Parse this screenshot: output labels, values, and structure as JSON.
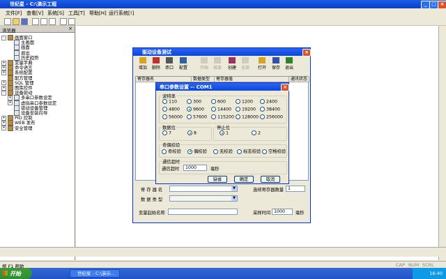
{
  "app": {
    "title": "世纪星 - C:\\演示工程"
  },
  "menu": [
    "文件[F]",
    "查看[V]",
    "系统[S]",
    "工具[T]",
    "帮助[H]",
    "运行系统[!]"
  ],
  "sidebar": {
    "header": "浏览器",
    "items": [
      {
        "label": "画面窗口",
        "level": 0,
        "expander": "-"
      },
      {
        "label": "主画面",
        "level": 1,
        "expander": ""
      },
      {
        "label": "画面",
        "level": 1,
        "expander": ""
      },
      {
        "label": "退出",
        "level": 1,
        "expander": ""
      },
      {
        "label": "历史趋势",
        "level": 1,
        "expander": ""
      },
      {
        "label": "变量字典",
        "level": 0,
        "expander": "+"
      },
      {
        "label": "命令语言",
        "level": 0,
        "expander": "+"
      },
      {
        "label": "系统配置",
        "level": 0,
        "expander": "+"
      },
      {
        "label": "配方管理",
        "level": 0,
        "expander": ""
      },
      {
        "label": "SQL 管理",
        "level": 0,
        "expander": "+"
      },
      {
        "label": "图库控件",
        "level": 0,
        "expander": "+"
      },
      {
        "label": "设备驱动",
        "level": 0,
        "expander": "-"
      },
      {
        "label": "多串口参数设定",
        "level": 1,
        "expander": "+"
      },
      {
        "label": "虚拟串口参数设定",
        "level": 1,
        "expander": "+"
      },
      {
        "label": "驱动设备管理",
        "level": 1,
        "expander": ""
      },
      {
        "label": "设备安装向导",
        "level": 1,
        "expander": ""
      },
      {
        "label": "PID 控制",
        "level": 0,
        "expander": "+"
      },
      {
        "label": "WEB 发布",
        "level": 0,
        "expander": "+"
      },
      {
        "label": "安全管理",
        "level": 0,
        "expander": "+"
      }
    ]
  },
  "driver_dialog": {
    "title": "驱动设备测试",
    "toolbar": [
      {
        "label": "增加",
        "enabled": true
      },
      {
        "label": "删除",
        "enabled": true
      },
      {
        "label": "串口",
        "enabled": true
      },
      {
        "label": "配置",
        "enabled": true
      },
      {
        "label": "开始",
        "enabled": false
      },
      {
        "label": "结束",
        "enabled": false
      },
      {
        "label": "创建",
        "enabled": true
      },
      {
        "label": "全部",
        "enabled": false
      },
      {
        "label": "打开",
        "enabled": true
      },
      {
        "label": "保存",
        "enabled": true
      },
      {
        "label": "退出",
        "enabled": true
      }
    ],
    "columns": [
      "寄存器名",
      "数据类型",
      "寄存器值",
      "通讯状态"
    ],
    "register_name_label": "寄 存 器 名",
    "register_count_label": "连续寄存器数量",
    "register_count_value": "1",
    "data_type_label": "数 据 类 型",
    "var_link_label": "变量起始名称",
    "sample_time_label": "采样时间",
    "sample_time_value": "1000",
    "sample_time_unit": "毫秒"
  },
  "serial_dialog": {
    "title": "串口参数设置 -- COM1",
    "baud_group": "波特率",
    "baud_rates": [
      "110",
      "300",
      "600",
      "1200",
      "2400",
      "4800",
      "9600",
      "14400",
      "19200",
      "38400",
      "56000",
      "57600",
      "115200",
      "128000",
      "256000"
    ],
    "baud_selected": "9600",
    "databits_group": "数据位",
    "databits": [
      "7",
      "8"
    ],
    "databits_selected": "8",
    "stopbits_group": "停止位",
    "stopbits": [
      "1",
      "2"
    ],
    "stopbits_selected": "1",
    "parity_group": "奇偶校验",
    "parity": [
      "奇校验",
      "偶校验",
      "无校验",
      "标志校验",
      "空格校验"
    ],
    "parity_selected": "偶校验",
    "timeout_group": "通信超时",
    "timeout_label": "通信超时",
    "timeout_value": "1000",
    "timeout_unit": "毫秒",
    "buttons": {
      "default": "缺省",
      "ok": "确定",
      "cancel": "取消"
    }
  },
  "status": {
    "help": "按 F1 帮助",
    "caps": "CAP",
    "num": "NUM",
    "scrl": "SCRL"
  },
  "taskbar": {
    "start": "开始",
    "task": "世纪星 - C:\\演示...",
    "clock": "16:40"
  }
}
